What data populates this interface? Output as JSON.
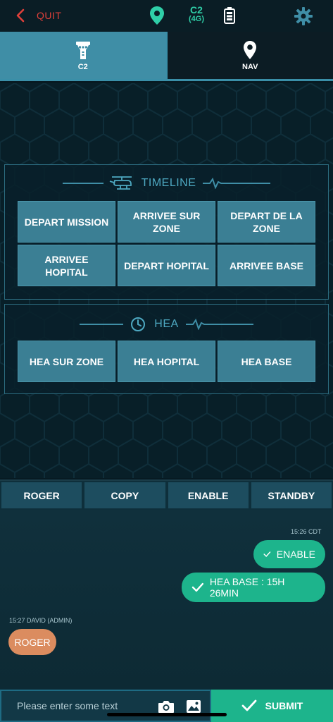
{
  "topbar": {
    "quit_label": "QUIT",
    "network_label": "C2",
    "network_sub": "(4G)",
    "location_icon": "map-pin-icon",
    "battery_icon": "battery-icon",
    "settings_icon": "gear-icon"
  },
  "tabs": [
    {
      "label": "C2",
      "icon": "control-tower-icon"
    },
    {
      "label": "NAV",
      "icon": "map-pin-icon"
    }
  ],
  "timeline": {
    "title": "TIMELINE",
    "buttons": [
      "DEPART MISSION",
      "ARRIVEE SUR ZONE",
      "DEPART DE LA ZONE",
      "ARRIVEE HOPITAL",
      "DEPART HOPITAL",
      "ARRIVEE BASE"
    ]
  },
  "hea": {
    "title": "HEA",
    "buttons": [
      "HEA SUR ZONE",
      "HEA HOPITAL",
      "HEA BASE"
    ]
  },
  "actions": [
    "ROGER",
    "COPY",
    "ENABLE",
    "STANDBY"
  ],
  "chat": {
    "outgoing_time": "15:26 CDT",
    "outgoing": [
      "ENABLE",
      "HEA BASE : 15H 26MIN"
    ],
    "incoming_meta": "15:27 DAVID (ADMIN)",
    "incoming": "ROGER"
  },
  "composer": {
    "placeholder": "Please enter some text",
    "submit_label": "SUBMIT"
  },
  "colors": {
    "accent": "#3f8ea6",
    "bubble_out": "#1db48c",
    "bubble_in": "#db8c5f",
    "quit": "#e0403a"
  }
}
